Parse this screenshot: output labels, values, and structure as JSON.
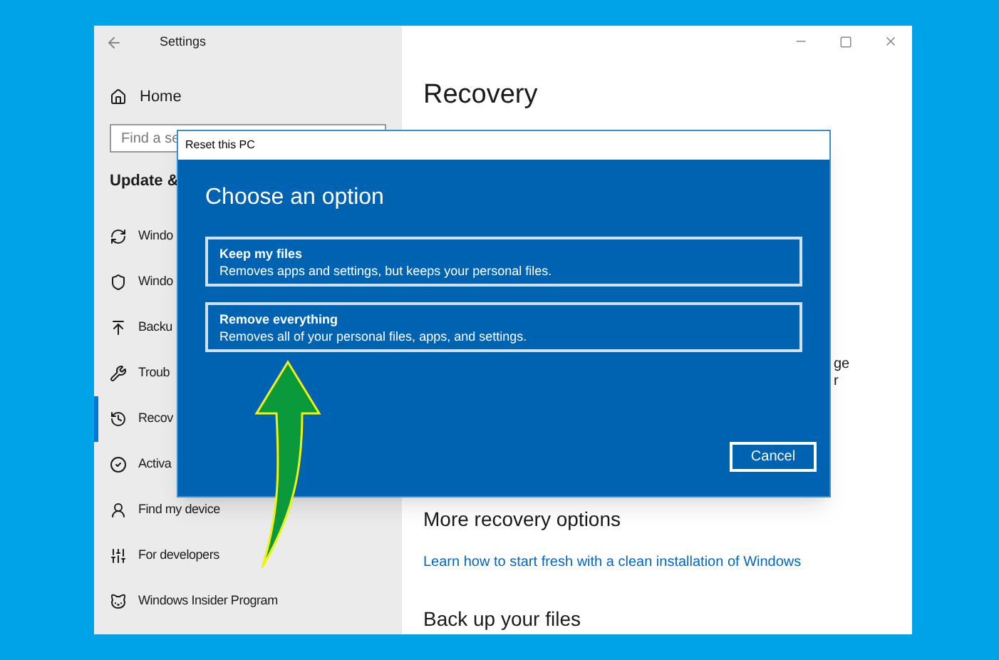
{
  "window": {
    "title": "Settings"
  },
  "sidebar": {
    "home": "Home",
    "search": {
      "placeholder": "Find a se"
    },
    "section": "Update &",
    "items": [
      {
        "label": "Windo",
        "selected": false
      },
      {
        "label": "Windo",
        "selected": false
      },
      {
        "label": "Backu",
        "selected": false
      },
      {
        "label": "Troub",
        "selected": false
      },
      {
        "label": "Recov",
        "selected": true
      },
      {
        "label": "Activa",
        "selected": false
      },
      {
        "label": "Find my device",
        "selected": false
      },
      {
        "label": "For developers",
        "selected": false
      },
      {
        "label": "Windows Insider Program",
        "selected": false
      }
    ]
  },
  "content": {
    "title": "Recovery",
    "fragments": [
      "ge",
      "r"
    ],
    "sections": [
      {
        "kind": "heading",
        "text": "More recovery options"
      },
      {
        "kind": "link",
        "text": "Learn how to start fresh with a clean installation of Windows"
      },
      {
        "kind": "heading",
        "text": "Back up your files"
      }
    ]
  },
  "dialog": {
    "title": "Reset this PC",
    "heading": "Choose an option",
    "options": [
      {
        "title": "Keep my files",
        "description": "Removes apps and settings, but keeps your personal files."
      },
      {
        "title": "Remove everything",
        "description": "Removes all of your personal files, apps, and settings."
      }
    ],
    "cancel": "Cancel"
  }
}
